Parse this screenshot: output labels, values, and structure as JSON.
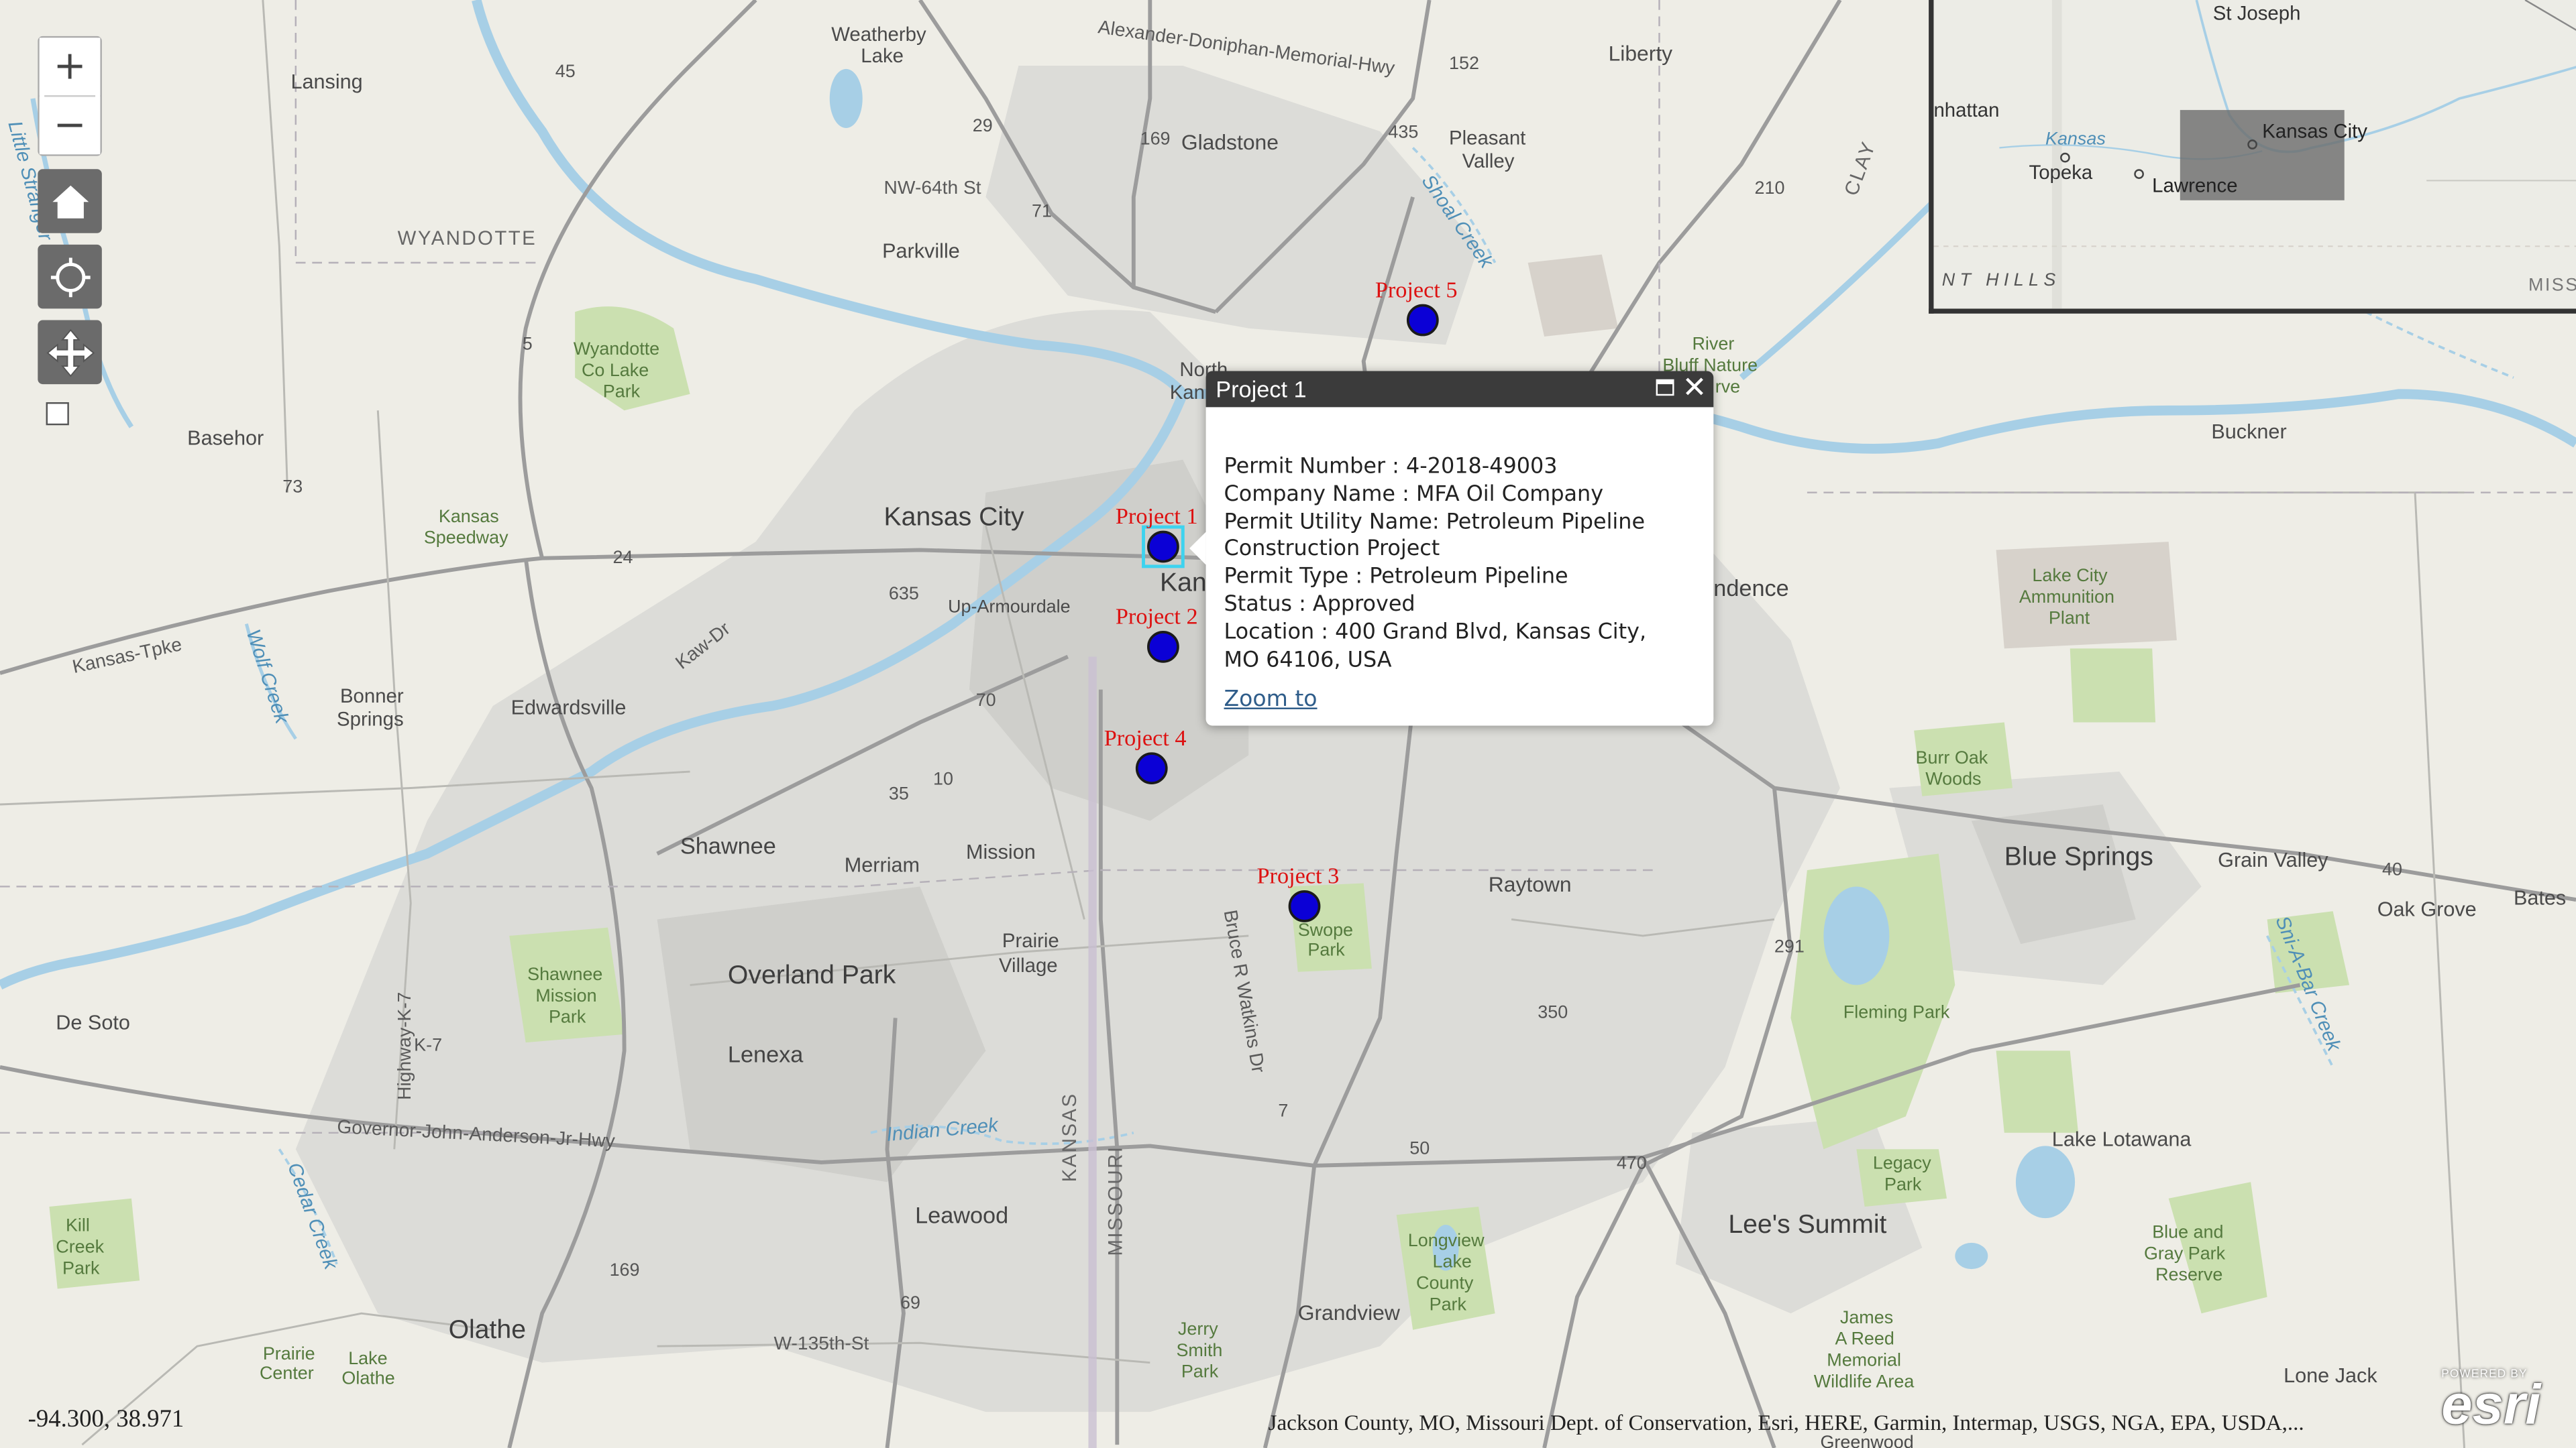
{
  "controls": {
    "zoom_in": "+",
    "zoom_out": "−",
    "home_icon": "home-icon",
    "locate_icon": "locate-icon",
    "pan_icon": "pan-icon"
  },
  "popup": {
    "title": "Project 1",
    "lines": [
      "Permit Number : 4-2018-49003",
      "Company Name : MFA Oil Company",
      "Permit Utility Name: Petroleum Pipeline",
      "Construction Project",
      "Permit Type : Petroleum Pipeline",
      "Status : Approved",
      "Location : 400 Grand Blvd, Kansas City,",
      "MO 64106, USA"
    ],
    "zoom_link": "Zoom to"
  },
  "projects": [
    {
      "label": "Project 1"
    },
    {
      "label": "Project 2"
    },
    {
      "label": "Project 3"
    },
    {
      "label": "Project 4"
    },
    {
      "label": "Project 5"
    }
  ],
  "place_labels": {
    "kansas_city": "Kansas City",
    "overland_park": "Overland Park",
    "olathe": "Olathe",
    "lees_summit": "Lee's Summit",
    "blue_springs": "Blue Springs",
    "shawnee": "Shawnee",
    "lenexa": "Lenexa",
    "leawood": "Leawood",
    "raytown": "Raytown",
    "grandview": "Grandview",
    "gladstone": "Gladstone",
    "liberty": "Liberty",
    "parkville": "Parkville",
    "lansing": "Lansing",
    "basehor": "Basehor",
    "merriam": "Merriam",
    "mission": "Mission",
    "edwardsville": "Edwardsville",
    "de_soto": "De Soto",
    "buckner": "Buckner",
    "grain_valley": "Grain Valley",
    "oak_grove": "Oak Grove",
    "lake_lotawana": "Lake Lotawana",
    "lone_jack": "Lone Jack",
    "weatherby": "Weatherby",
    "weatherby2": "Lake",
    "pleasant": "Pleasant",
    "pleasant2": "Valley",
    "bonner": "Bonner",
    "bonner2": "Springs",
    "prairie": "Prairie",
    "prairie2": "Village",
    "north_kc": "North",
    "north_kc2": "Kan",
    "kc_mo_partial": "Kan",
    "independence_partial": "ndence",
    "up_armourdale": "Up-Armourdale",
    "wyandotte": "WYANDOTTE",
    "clay": "CLAY",
    "kansas_state": "KANSAS",
    "missouri_state": "MISSOURI",
    "nw64": "NW-64th St",
    "w135": "W-135th-St",
    "kansas_tpke": "Kansas-Tpke",
    "gov_john": "Governor-John-Anderson-Jr-Hwy",
    "bruce": "Bruce R Watkins Dr",
    "alex": "Alexander-Doniphan-Memorial-Hwy",
    "kaw": "Kaw-Dr",
    "hwy_k7": "Highway-K-7",
    "little_stranger": "Little Stranger",
    "wolf_creek": "Wolf Creek",
    "shoal_creek": "Shoal Creek",
    "indian_creek": "Indian Creek",
    "cedar_creek": "Cedar Creek",
    "sni_a_bar": "Sni-A-Bar Creek",
    "bates": "Bates",
    "burr_oak": "Burr Oak",
    "burr_oak2": "Woods",
    "fleming": "Fleming Park",
    "legacy": "Legacy",
    "legacy2": "Park",
    "blue_gray": "Blue and",
    "blue_gray2": "Gray Park",
    "blue_gray3": "Reserve",
    "longview": "Longview",
    "longview2": "Lake",
    "longview3": "County",
    "longview4": "Park",
    "james_reed": "James",
    "james_reed2": "A Reed",
    "james_reed3": "Memorial",
    "james_reed4": "Wildlife Area",
    "jerry": "Jerry",
    "jerry2": "Smith",
    "jerry3": "Park",
    "swope": "Swope",
    "swope2": "Park",
    "shawnee_mission": "Shawnee",
    "shawnee_mission2": "Mission",
    "shawnee_mission3": "Park",
    "kill_creek": "Kill",
    "kill_creek2": "Creek",
    "kill_creek3": "Park",
    "prairie_center": "Prairie",
    "prairie_center2": "Center",
    "lake_olathe": "Lake",
    "lake_olathe2": "Olathe",
    "wyandotte_lake": "Wyandotte",
    "wyandotte_lake2": "Co Lake",
    "wyandotte_lake3": "Park",
    "kansas_speedway": "Kansas",
    "kansas_speedway2": "Speedway",
    "lake_city": "Lake City",
    "lake_city2": "Ammunition",
    "lake_city3": "Plant",
    "river_bluff": "River",
    "river_bluff2": "Bluff Nature",
    "river_bluff3": "rve",
    "greenwood": "Greenwood"
  },
  "road_shields": [
    "45",
    "152",
    "29",
    "169",
    "435",
    "210",
    "5",
    "24",
    "635",
    "73",
    "35",
    "70",
    "291",
    "40",
    "350",
    "7",
    "71",
    "50",
    "470",
    "69",
    "169",
    "K-7",
    "10"
  ],
  "overview": {
    "labels": [
      "St Joseph",
      "nhattan",
      "Kansas",
      "Kansas City",
      "Topeka",
      "Lawrence",
      "NT  HILLS",
      "MISS"
    ]
  },
  "coords": "-94.300, 38.971",
  "attribution": "Jackson County, MO, Missouri Dept. of Conservation, Esri, HERE, Garmin, Intermap, USGS, NGA, EPA, USDA,...",
  "esri": {
    "powered": "POWERED BY",
    "logo": "esri"
  },
  "colors": {
    "marker": "#0b00d6",
    "marker_stroke": "#1a1a1a",
    "project_label": "#dd1111",
    "popup_header": "#3b3b3b",
    "river": "#a7cfe6"
  }
}
